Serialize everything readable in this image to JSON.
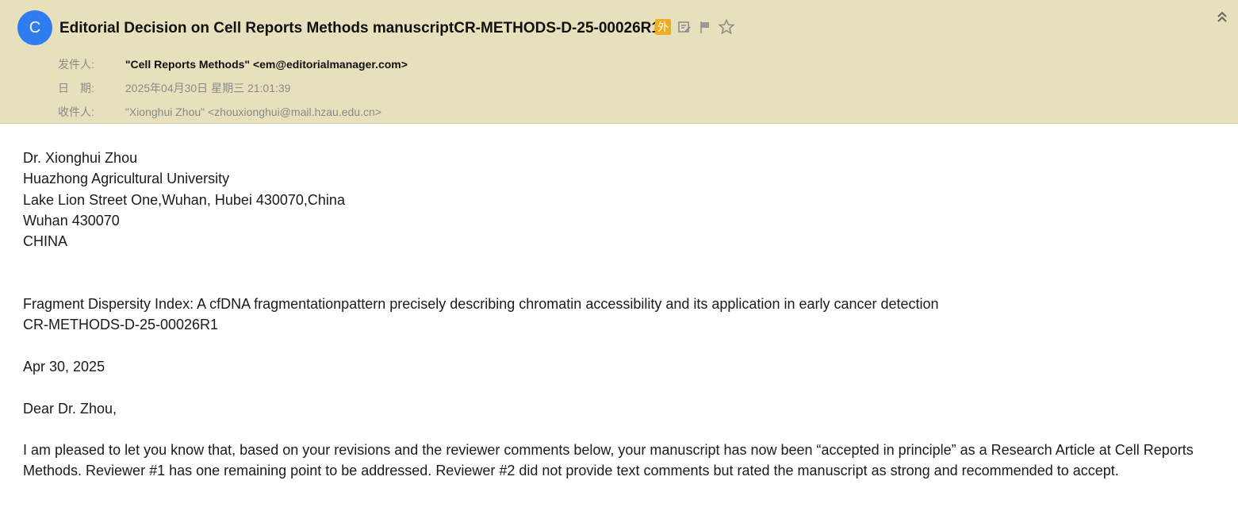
{
  "avatar": {
    "letter": "C",
    "color": "#2f7bf0"
  },
  "subject": "Editorial Decision on Cell Reports Methods manuscriptCR-METHODS-D-25-00026R1",
  "subject_icons": {
    "external_badge": "外",
    "icon_names": [
      "external-badge-icon",
      "edit-icon",
      "flag-icon",
      "star-icon",
      "collapse-icon"
    ]
  },
  "meta": {
    "from_label": "发件人:",
    "from_value": "\"Cell Reports Methods\" <em@editorialmanager.com>",
    "date_label": "日　期:",
    "date_value": "2025年04月30日 星期三 21:01:39",
    "to_label": "收件人:",
    "to_value": "\"Xionghui Zhou\" <zhouxionghui@mail.hzau.edu.cn>"
  },
  "body": {
    "address_lines": [
      "Dr. Xionghui Zhou",
      "Huazhong Agricultural University",
      "Lake Lion Street One,Wuhan, Hubei 430070,China",
      "Wuhan 430070",
      "CHINA"
    ],
    "title_line": "Fragment Dispersity Index: A cfDNA fragmentationpattern precisely describing chromatin accessibility and its application in early cancer detection",
    "manuscript_id": "CR-METHODS-D-25-00026R1",
    "date": "Apr 30, 2025",
    "greeting": "Dear Dr. Zhou,",
    "paragraph1": "I am pleased to let you know that, based on your revisions and the reviewer comments below, your manuscript has now been “accepted in principle” as a Research Article at Cell Reports Methods. Reviewer #1 has one remaining point to be addressed. Reviewer #2 did not provide text comments but rated the manuscript as strong and recommended to accept."
  },
  "colors": {
    "header_bg": "#e7e0bd",
    "badge": "#f0ad1e"
  }
}
